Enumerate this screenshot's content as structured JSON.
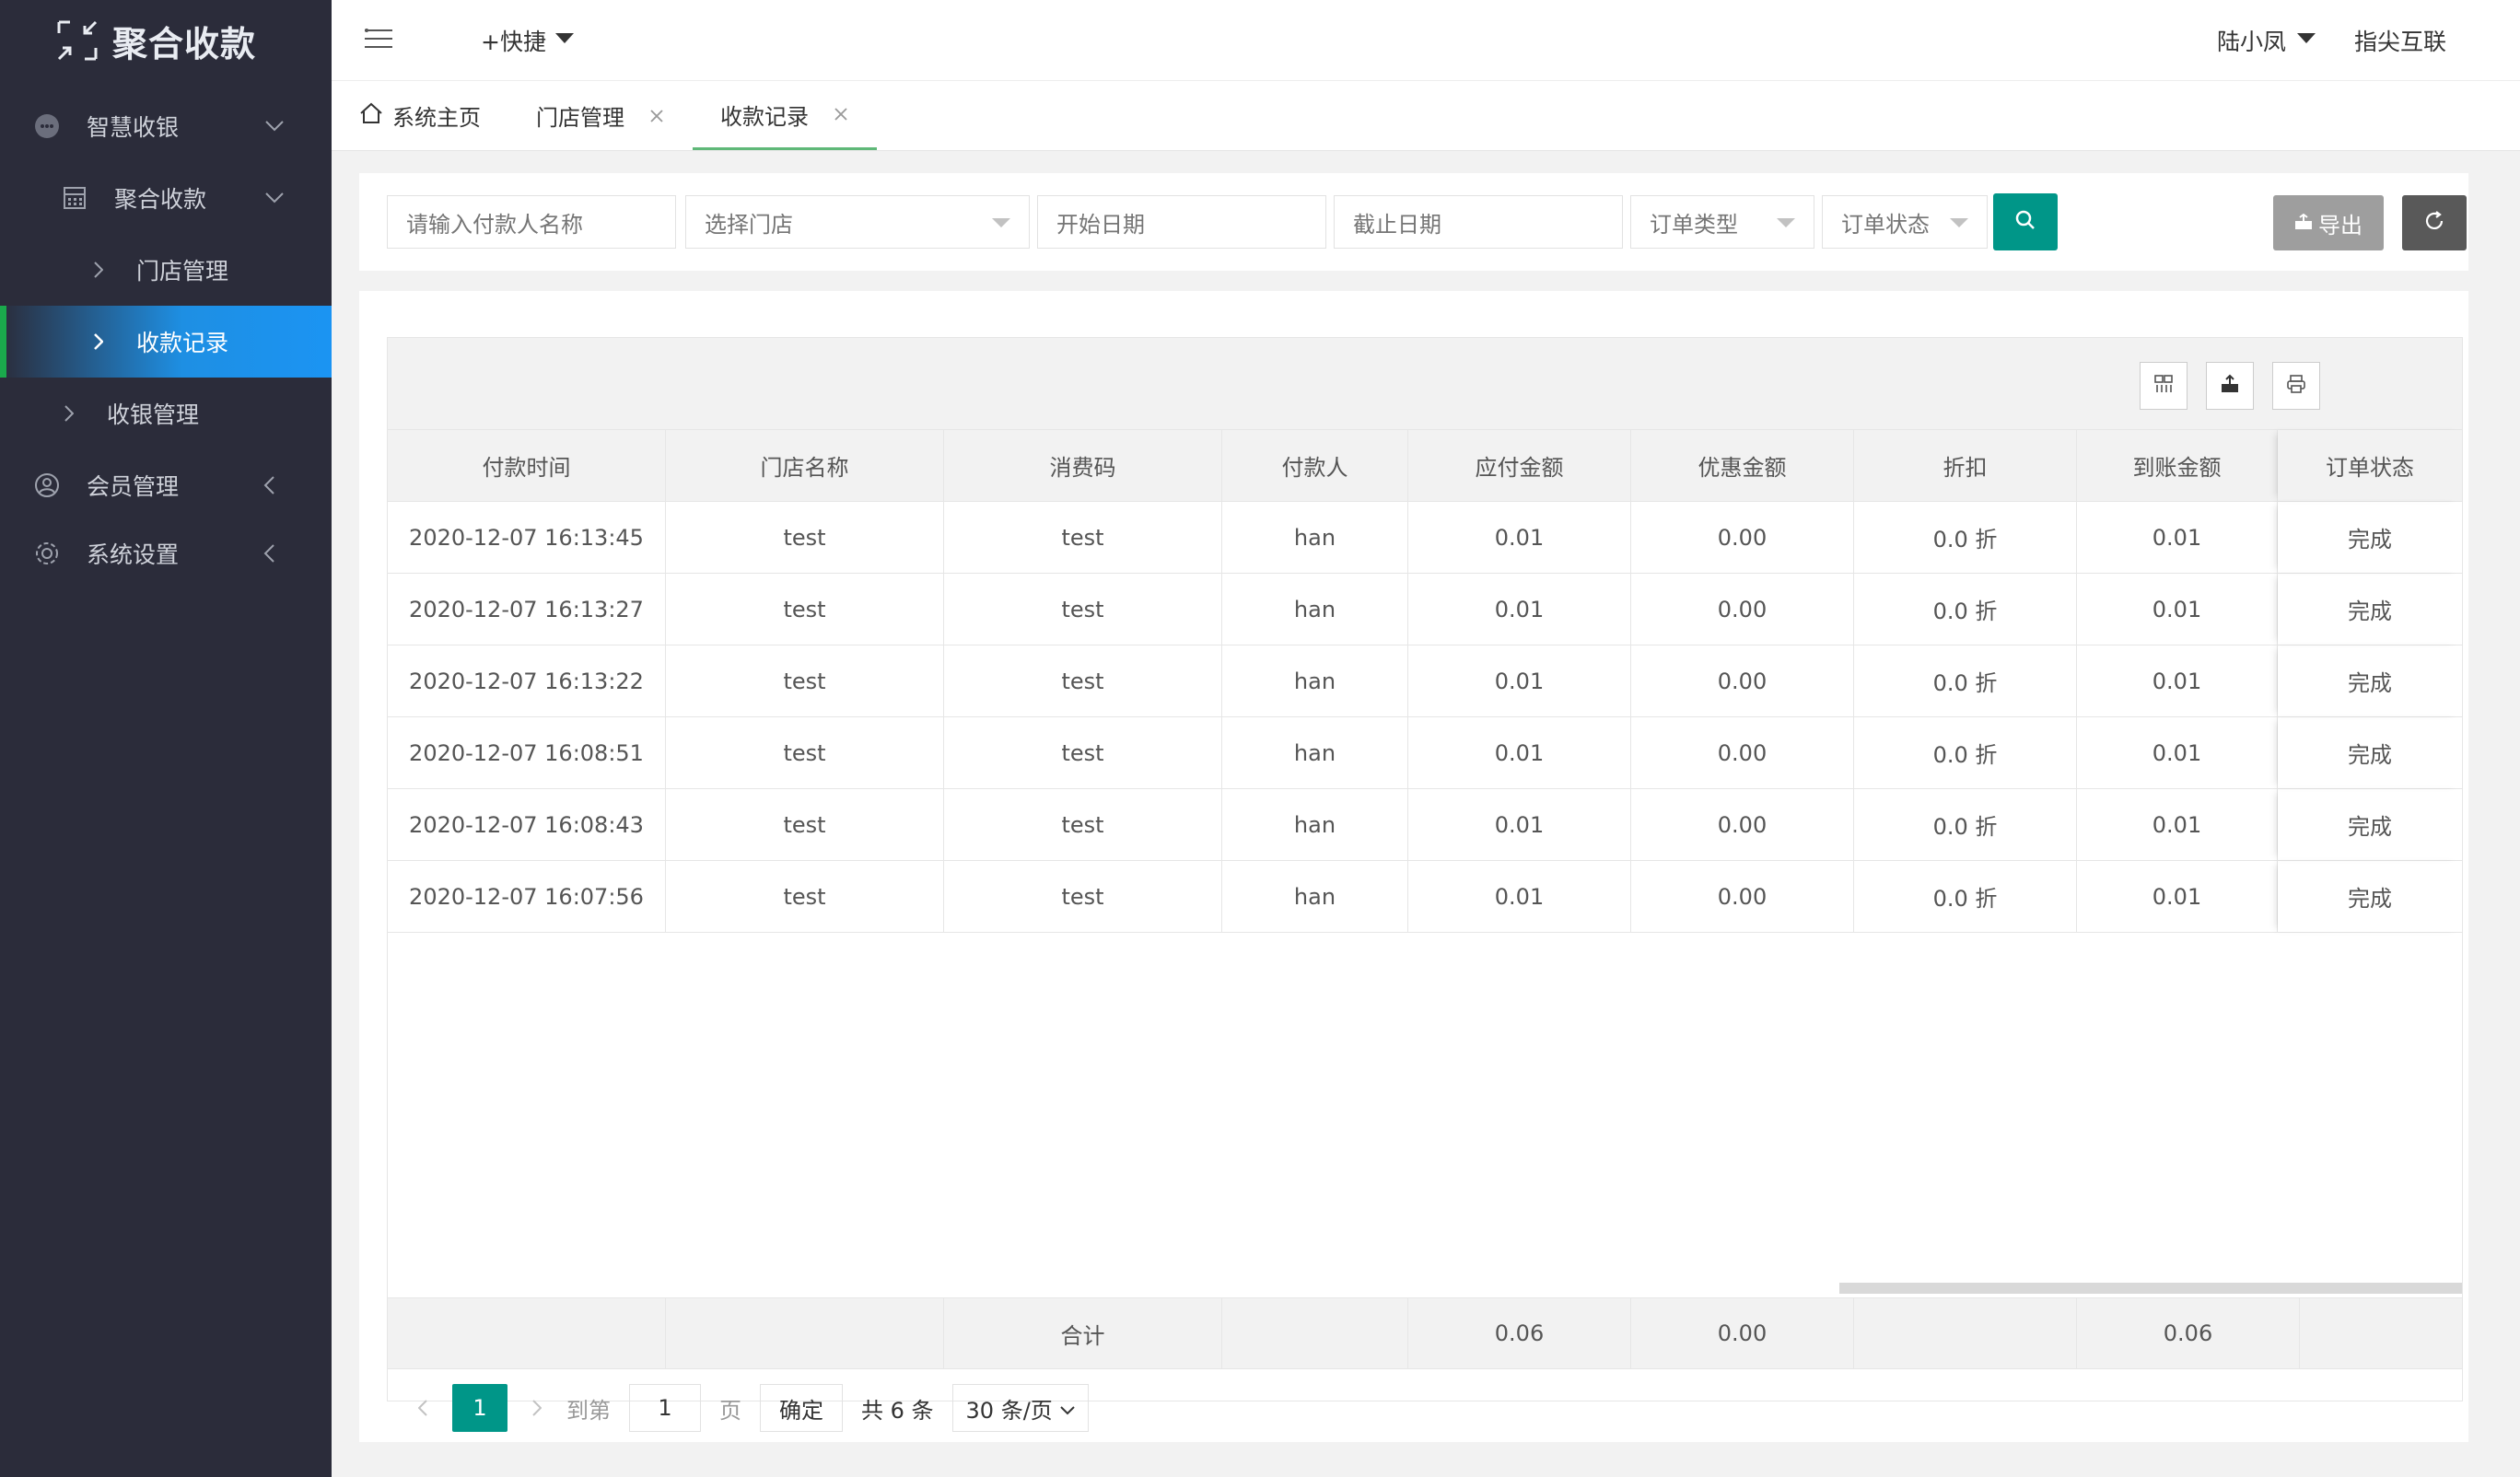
{
  "app": {
    "title": "聚合收款"
  },
  "sidebar": {
    "items": [
      {
        "label": "智慧收银",
        "icon": "chat-bubble-icon"
      },
      {
        "label": "聚合收款",
        "icon": "calculator-icon"
      },
      {
        "label": "门店管理"
      },
      {
        "label": "收款记录"
      },
      {
        "label": "收银管理"
      },
      {
        "label": "会员管理",
        "icon": "user-circle-icon"
      },
      {
        "label": "系统设置",
        "icon": "gear-icon"
      }
    ],
    "active_color": "#1b94f3",
    "active_marker_color": "#1aa94c"
  },
  "header": {
    "quick": "+快捷",
    "user": "陆小凤",
    "brand": "指尖互联"
  },
  "tabs": [
    {
      "label": "系统主页"
    },
    {
      "label": "门店管理"
    },
    {
      "label": "收款记录"
    }
  ],
  "search": {
    "payer_placeholder": "请输入付款人名称",
    "store_placeholder": "选择门店",
    "start_placeholder": "开始日期",
    "end_placeholder": "截止日期",
    "order_type_placeholder": "订单类型",
    "order_status_placeholder": "订单状态",
    "export_label": "导出"
  },
  "table": {
    "columns": [
      "付款时间",
      "门店名称",
      "消费码",
      "付款人",
      "应付金额",
      "优惠金额",
      "折扣",
      "到账金额",
      "订单状态"
    ],
    "rows": [
      [
        "2020-12-07 16:13:45",
        "test",
        "test",
        "han",
        "0.01",
        "0.00",
        "0.0 折",
        "0.01",
        "完成"
      ],
      [
        "2020-12-07 16:13:27",
        "test",
        "test",
        "han",
        "0.01",
        "0.00",
        "0.0 折",
        "0.01",
        "完成"
      ],
      [
        "2020-12-07 16:13:22",
        "test",
        "test",
        "han",
        "0.01",
        "0.00",
        "0.0 折",
        "0.01",
        "完成"
      ],
      [
        "2020-12-07 16:08:51",
        "test",
        "test",
        "han",
        "0.01",
        "0.00",
        "0.0 折",
        "0.01",
        "完成"
      ],
      [
        "2020-12-07 16:08:43",
        "test",
        "test",
        "han",
        "0.01",
        "0.00",
        "0.0 折",
        "0.01",
        "完成"
      ],
      [
        "2020-12-07 16:07:56",
        "test",
        "test",
        "han",
        "0.01",
        "0.00",
        "0.0 折",
        "0.01",
        "完成"
      ]
    ],
    "totals": {
      "label": "合计",
      "payable": "0.06",
      "discount": "0.00",
      "received": "0.06"
    }
  },
  "pager": {
    "current_page": "1",
    "goto_label": "到第",
    "goto_value": "1",
    "page_unit": "页",
    "confirm": "确定",
    "total": "共 6 条",
    "per_page": "30 条/页"
  }
}
